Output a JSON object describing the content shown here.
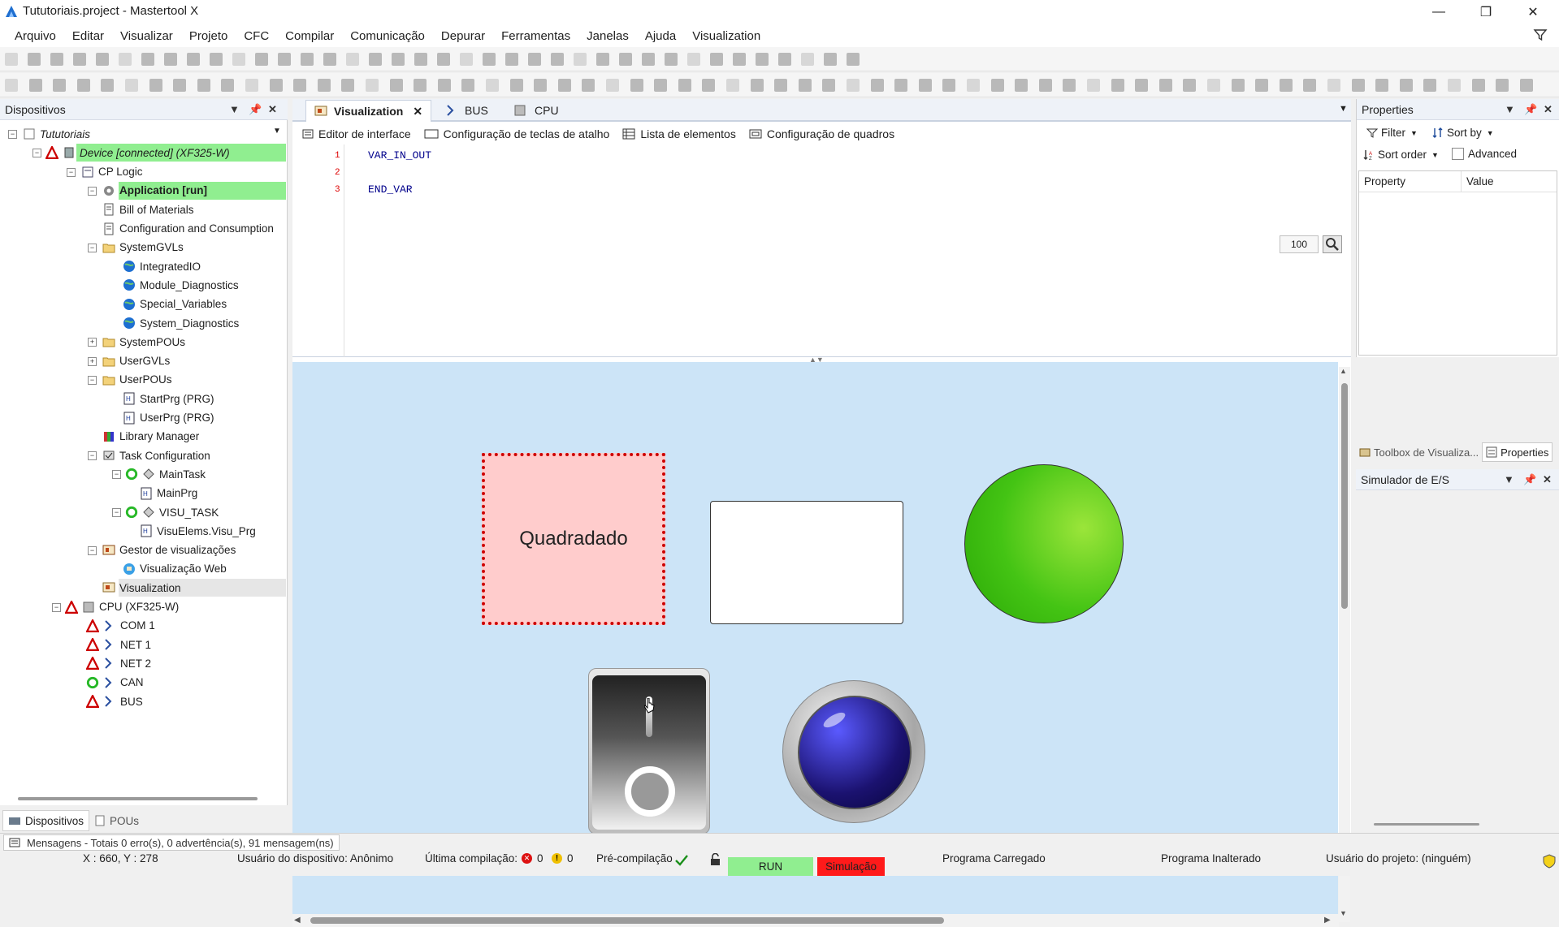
{
  "window": {
    "title": "Tututoriais.project - Mastertool X",
    "controls": [
      "minimize-icon",
      "restore-icon",
      "close-icon"
    ]
  },
  "menu": [
    "Arquivo",
    "Editar",
    "Visualizar",
    "Projeto",
    "CFC",
    "Compilar",
    "Comunicação",
    "Depurar",
    "Ferramentas",
    "Janelas",
    "Ajuda",
    "Visualization"
  ],
  "devices_panel": {
    "title": "Dispositivos",
    "tree": [
      {
        "label": "Tututoriais",
        "icon": "project-icon"
      },
      {
        "label": "Device [connected] (XF325-W)",
        "icon": "device-icon"
      },
      {
        "label": "CP Logic",
        "icon": "plc-icon"
      },
      {
        "label": "Application [run]",
        "icon": "gear-icon"
      },
      {
        "label": "Bill of Materials",
        "icon": "doc-icon"
      },
      {
        "label": "Configuration and Consumption",
        "icon": "doc-icon"
      },
      {
        "label": "SystemGVLs",
        "icon": "folder-icon"
      },
      {
        "label": "IntegratedIO",
        "icon": "globe-icon"
      },
      {
        "label": "Module_Diagnostics",
        "icon": "globe-icon"
      },
      {
        "label": "Special_Variables",
        "icon": "globe-icon"
      },
      {
        "label": "System_Diagnostics",
        "icon": "globe-icon"
      },
      {
        "label": "SystemPOUs",
        "icon": "folder-icon"
      },
      {
        "label": "UserGVLs",
        "icon": "folder-icon"
      },
      {
        "label": "UserPOUs",
        "icon": "folder-icon"
      },
      {
        "label": "StartPrg (PRG)",
        "icon": "program-icon"
      },
      {
        "label": "UserPrg (PRG)",
        "icon": "program-icon"
      },
      {
        "label": "Library Manager",
        "icon": "library-icon"
      },
      {
        "label": "Task Configuration",
        "icon": "task-config-icon"
      },
      {
        "label": "MainTask",
        "icon": "task-icon"
      },
      {
        "label": "MainPrg",
        "icon": "program-icon"
      },
      {
        "label": "VISU_TASK",
        "icon": "task-icon"
      },
      {
        "label": "VisuElems.Visu_Prg",
        "icon": "program-icon"
      },
      {
        "label": "Gestor de visualizações",
        "icon": "visu-manager-icon"
      },
      {
        "label": "Visualização Web",
        "icon": "web-visu-icon"
      },
      {
        "label": "Visualization",
        "icon": "visu-icon"
      },
      {
        "label": "CPU (XF325-W)",
        "icon": "cpu-icon"
      },
      {
        "label": "COM 1",
        "icon": "com-icon"
      },
      {
        "label": "NET 1",
        "icon": "net-icon"
      },
      {
        "label": "NET 2",
        "icon": "net-icon"
      },
      {
        "label": "CAN",
        "icon": "can-icon"
      },
      {
        "label": "BUS",
        "icon": "bus-icon"
      }
    ],
    "bottom_tabs": [
      "Dispositivos",
      "POUs"
    ]
  },
  "editor": {
    "tabs": [
      "Visualization",
      "BUS",
      "CPU"
    ],
    "subtabs": [
      "Editor de interface",
      "Configuração de teclas de atalho",
      "Lista de elementos",
      "Configuração de quadros"
    ],
    "code_lines": [
      {
        "num": "1",
        "text": "VAR_IN_OUT"
      },
      {
        "num": "2",
        "text": ""
      },
      {
        "num": "3",
        "text": "END_VAR"
      }
    ],
    "zoom": "100",
    "canvas": {
      "rect_label": "Quadradado",
      "colors": {
        "background": "#cce4f7",
        "rect_fill": "#ffcccc",
        "rect_border": "#cc0000",
        "circle_fill": "#44c414"
      }
    }
  },
  "properties_panel": {
    "title": "Properties",
    "filter": "Filter",
    "sort_by": "Sort by",
    "sort_order": "Sort order",
    "advanced": "Advanced",
    "columns": [
      "Property",
      "Value"
    ],
    "bottom_tabs": [
      "Toolbox de Visualiza...",
      "Properties"
    ]
  },
  "io_sim_panel": {
    "title": "Simulador de E/S"
  },
  "messages": "Mensagens - Totais 0 erro(s), 0 advertência(s), 91 mensagem(ns)",
  "status": {
    "coords": "X : 660, Y : 278",
    "device_user": "Usuário do dispositivo: Anônimo",
    "last_compile": "Última compilação:",
    "errors": "0",
    "warnings": "0",
    "precompile": "Pré-compilação",
    "run": "RUN",
    "simulation": "Simulação",
    "program_loaded": "Programa Carregado",
    "program_unchanged": "Programa Inalterado",
    "project_user": "Usuário do projeto: (ninguém)"
  }
}
